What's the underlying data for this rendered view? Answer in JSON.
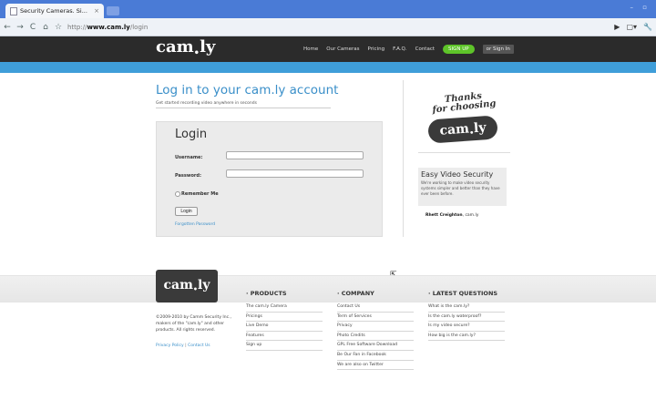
{
  "browser": {
    "tab_title": "Security Cameras. Si...",
    "tab_close": "×",
    "url_prefix": "http://",
    "url_host": "www.cam.ly",
    "url_path": "/login",
    "window_controls": "– ▫",
    "nav_back": "←",
    "nav_forward": "→",
    "nav_reload": "C",
    "nav_home": "⌂",
    "nav_star": "☆",
    "toolbar_right": [
      "▶",
      "▢▾",
      "🔧"
    ]
  },
  "header": {
    "logo_main": "cam",
    "logo_sub": "•",
    "logo_tail": "ly",
    "nav": [
      "Home",
      "Our Cameras",
      "Pricing",
      "F.A.Q.",
      "Contact"
    ],
    "signup": "SIGN UP",
    "signin": "or Sign In"
  },
  "main": {
    "title": "Log in to your cam.ly account",
    "subtitle": "Get started recording video anywhere in seconds",
    "login": {
      "heading": "Login",
      "username_label": "Username:",
      "username_value": "",
      "password_label": "Password:",
      "password_value": "",
      "remember_label": "Remember Me",
      "remember_checked": false,
      "button_label": "Login",
      "forgot_link": "Forgotten Password"
    }
  },
  "sidebar": {
    "thanks_line1": "Thanks",
    "thanks_line2": "for choosing",
    "badge_main": "cam",
    "badge_sub": "•",
    "badge_tail": "ly",
    "testimonial_title": "Easy Video Security",
    "testimonial_body": "We're working to make video security systems simpler and better than they have ever been before.",
    "testimonial_author": "Rhett Creighton",
    "testimonial_company": ", cam.ly"
  },
  "footer": {
    "logo_main": "cam",
    "logo_sub": "•",
    "logo_tail": "ly",
    "copyright": "©2009-2010 by Camm Security Inc., makers of the \"cam.ly\" and other products. All rights reserved.",
    "privacy_link": "Privacy Policy",
    "separator": "|",
    "contact_link": "Contact Us",
    "products": {
      "heading": "· PRODUCTS",
      "items": [
        "The cam.ly Camera",
        "Pricings",
        "Live Demo",
        "Features",
        "Sign up"
      ]
    },
    "company": {
      "heading": "· COMPANY",
      "items": [
        "Contact Us",
        "Term of Services",
        "Privacy",
        "Photo Credits",
        "GPL Free Software Download",
        "Be Our Fan in Facebook",
        "We are also on Twitter"
      ]
    },
    "questions": {
      "heading": "· LATEST QUESTIONS",
      "items": [
        "What is the cam.ly?",
        "Is the cam.ly waterproof?",
        "Is my video secure?",
        "How big is the cam.ly?"
      ]
    }
  },
  "colors": {
    "accent_blue": "#3a8fc9",
    "header_dark": "#2b2b2b",
    "signup_green": "#5ec429",
    "chrome_blue": "#4a7bd6"
  }
}
